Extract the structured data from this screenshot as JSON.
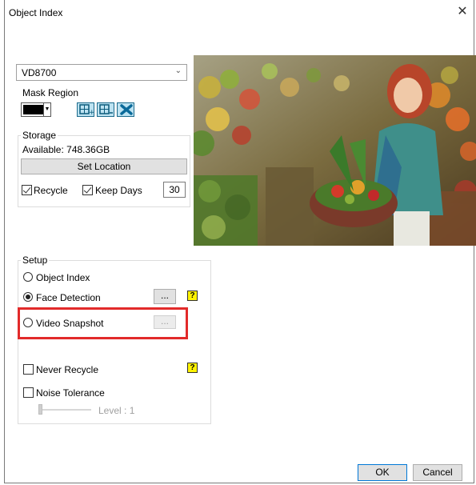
{
  "window": {
    "title": "Object Index"
  },
  "camera": {
    "selected": "VD8700"
  },
  "mask": {
    "label": "Mask Region"
  },
  "storage": {
    "legend": "Storage",
    "available": "Available: 748.36GB",
    "set_location": "Set Location",
    "recycle_label": "Recycle",
    "recycle_checked": true,
    "keep_days_label": "Keep Days",
    "keep_days_checked": true,
    "keep_days_value": "30"
  },
  "setup": {
    "legend": "Setup",
    "object_index": "Object Index",
    "face_detection": "Face Detection",
    "video_snapshot": "Video Snapshot",
    "browse": "...",
    "never_recycle": "Never Recycle",
    "noise_tolerance": "Noise Tolerance",
    "level": "Level : 1"
  },
  "footer": {
    "ok": "OK",
    "cancel": "Cancel"
  },
  "colors": {
    "highlight": "#e22a2a",
    "help": "#fff200",
    "toolbar": "#bde3f2"
  }
}
